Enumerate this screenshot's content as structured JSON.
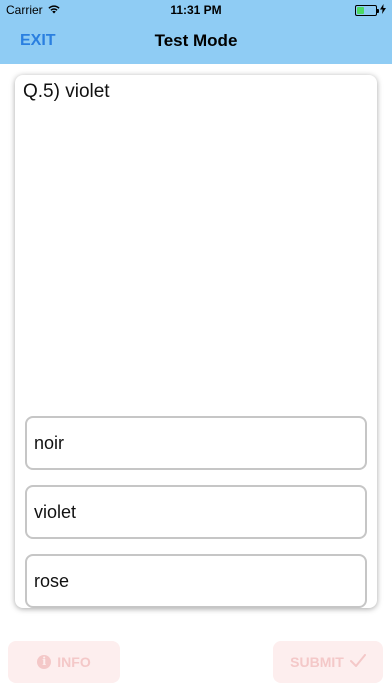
{
  "status_bar": {
    "carrier": "Carrier",
    "time": "11:31 PM",
    "battery_level": 0.4,
    "icons": [
      "wifi-icon",
      "battery-icon",
      "charging-bolt-icon"
    ]
  },
  "nav": {
    "exit_label": "EXIT",
    "title": "Test Mode"
  },
  "question": {
    "text": "Q.5) violet"
  },
  "options": [
    {
      "label": "noir"
    },
    {
      "label": "violet"
    },
    {
      "label": "rose"
    }
  ],
  "bottom": {
    "info_label": "INFO",
    "submit_label": "SUBMIT"
  },
  "colors": {
    "header_bg": "#8fccf4",
    "exit_text": "#2a7fe0",
    "bottom_btn_bg": "#fdeeee",
    "bottom_btn_text": "#f4c8c8"
  }
}
